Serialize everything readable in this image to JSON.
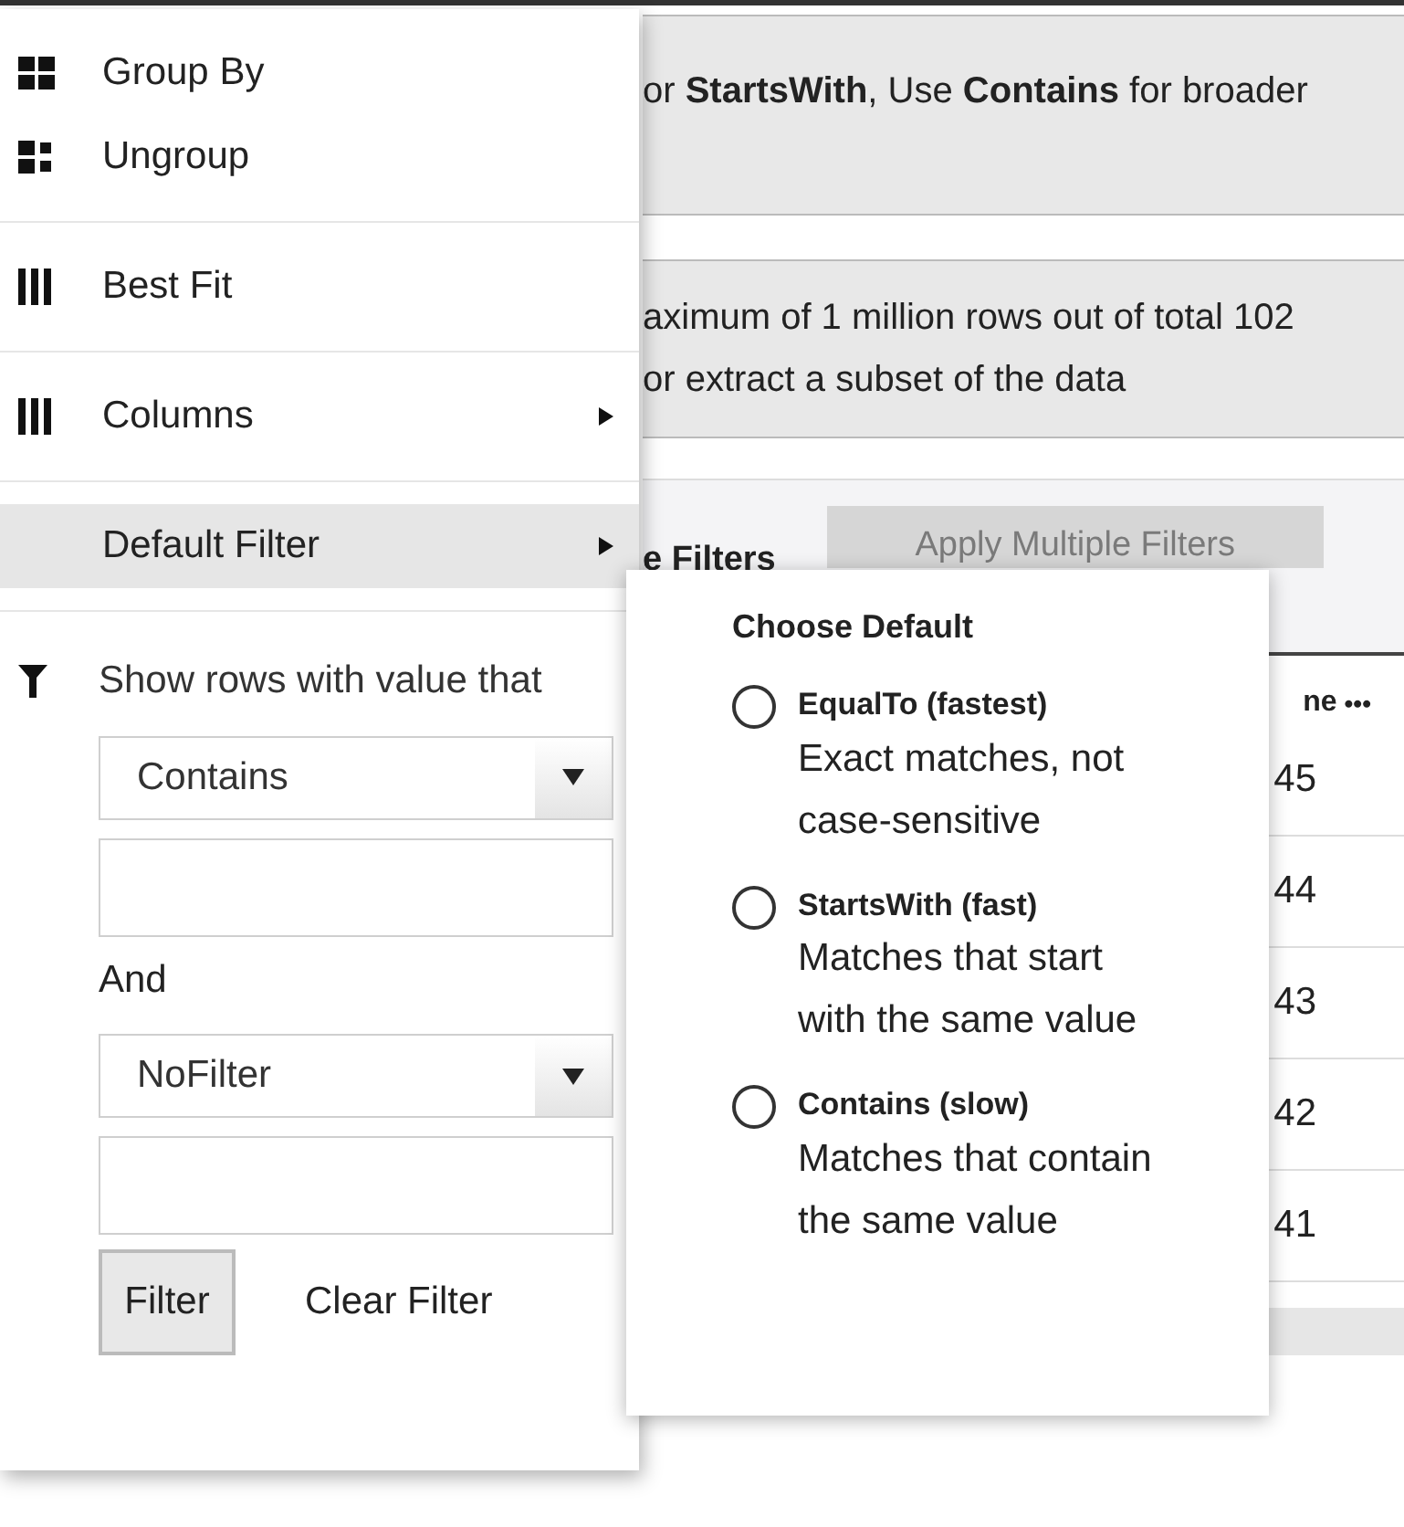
{
  "background": {
    "notice_1": "or **StartsWith**, Use **Contains** for broader",
    "notice_2_lines": [
      "aximum of 1 million rows out of total 102",
      "or extract a subset of the data"
    ],
    "toolbar_label": "e Filters",
    "apply_button": {
      "label": "Apply Multiple Filters",
      "disabled": true
    },
    "column_header": "ne",
    "column_menu": "•••",
    "rows": [
      "45",
      "44",
      "43",
      "42",
      "41"
    ]
  },
  "menu": {
    "groups": [
      [
        {
          "kind": "group_by",
          "label": "Group By",
          "submenu": false,
          "selected": false
        },
        {
          "kind": "ungroup",
          "label": "Ungroup",
          "submenu": false,
          "selected": false
        }
      ],
      [
        {
          "kind": "best_fit",
          "label": "Best Fit",
          "submenu": false,
          "selected": false
        }
      ],
      [
        {
          "kind": "columns",
          "label": "Columns",
          "submenu": true,
          "selected": false
        }
      ],
      [
        {
          "kind": "plain",
          "label": "Default Filter",
          "submenu": true,
          "selected": true
        }
      ]
    ],
    "filter": {
      "title": "Show rows with value that",
      "operator_1": "Contains",
      "conjunction": "And",
      "operator_2": "NoFilter",
      "filter_button": "Filter",
      "clear_button": "Clear Filter"
    }
  },
  "submenu": {
    "title": "Choose Default",
    "options": [
      {
        "label": "EqualTo (fastest)",
        "description": "Exact matches, not case-sensitive",
        "selected": false
      },
      {
        "label": "StartsWith (fast)",
        "description": "Matches that start with the same value",
        "selected": false
      },
      {
        "label": "Contains (slow)",
        "description": "Matches that contain the same value",
        "selected": false
      }
    ]
  }
}
